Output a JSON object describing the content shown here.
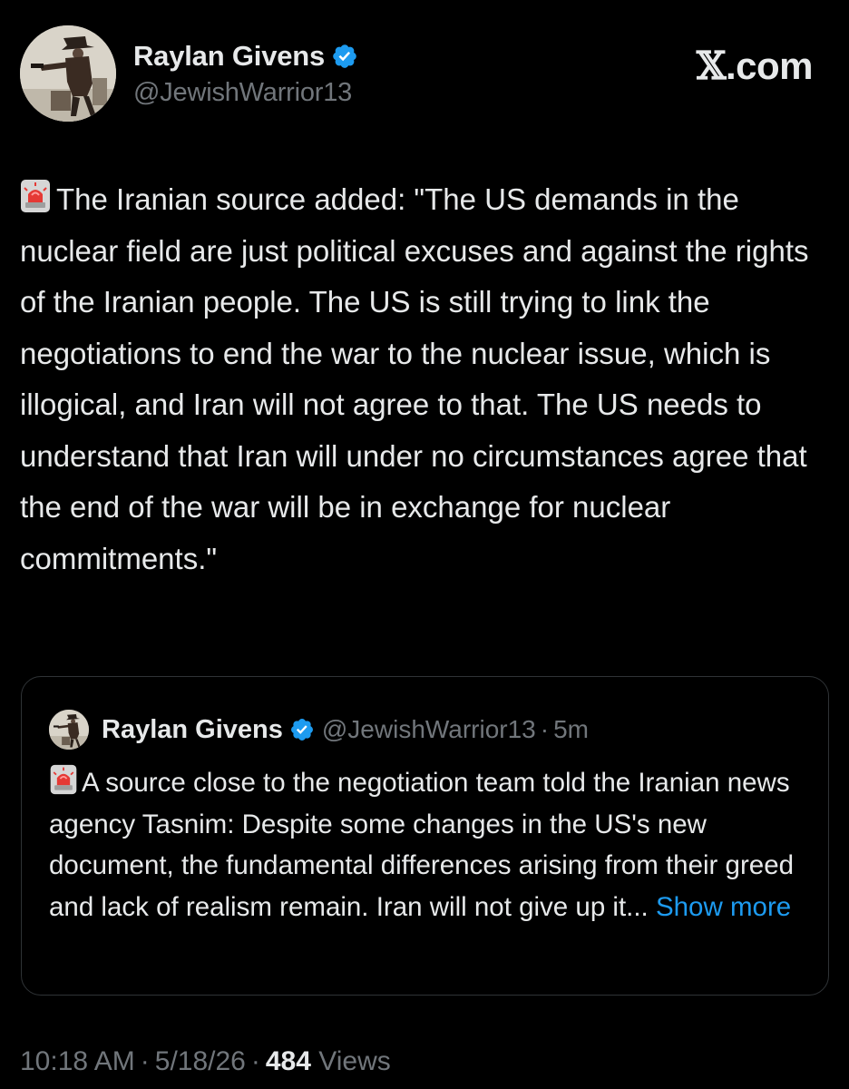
{
  "header": {
    "display_name": "Raylan Givens",
    "handle": "@JewishWarrior13",
    "brand_x": "𝕏",
    "brand_suffix": ".com",
    "avatar_icon": "western-gunslinger-avatar",
    "verified_icon": "verified-badge-icon"
  },
  "tweet": {
    "emoji_icon": "police-siren-icon",
    "text": "The Iranian source added: \"The US demands in the nuclear field are just political excuses and against the rights of the Iranian people. The US is still trying to link the negotiations to end the war to the nuclear issue, which is illogical, and Iran will not agree to that. The US needs to understand that Iran will under no circumstances agree that the end of the war will be in exchange for nuclear commitments.\""
  },
  "quote": {
    "display_name": "Raylan Givens",
    "handle": "@JewishWarrior13",
    "separator": "·",
    "time": "5m",
    "emoji_icon": "police-siren-icon",
    "text": "A source close to the negotiation team told the Iranian news agency Tasnim: Despite some changes in the US's new document, the fundamental differences arising from their greed and lack of realism remain. Iran will not give up it...",
    "show_more": "Show more"
  },
  "footer": {
    "time": "10:18 AM",
    "separator": "·",
    "date": "5/18/26",
    "views_count": "484",
    "views_label": "Views"
  },
  "colors": {
    "background": "#000000",
    "text_primary": "#e7e9ea",
    "text_secondary": "#71767b",
    "link": "#1d9bf0",
    "border": "#2f3336",
    "verified": "#1d9bf0"
  }
}
